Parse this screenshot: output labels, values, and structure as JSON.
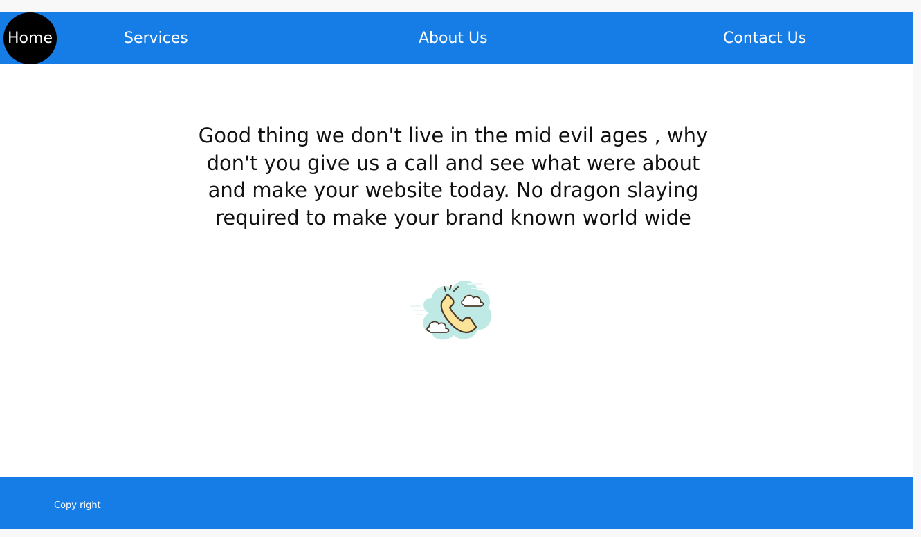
{
  "nav": {
    "home": "Home",
    "services": "Services",
    "about": "About Us",
    "contact": "Contact Us"
  },
  "main": {
    "message": "Good thing we don't live in the mid evil ages , why don't you give us a call and see what were about and make your website today. No dragon slaying required to make your brand known world wide",
    "icon": "phone-call-icon"
  },
  "footer": {
    "copyright": "Copy right"
  },
  "colors": {
    "nav_background": "#177de6",
    "home_circle": "#000000",
    "icon_cloud": "#bfe9e4",
    "icon_phone": "#fbe39a"
  }
}
